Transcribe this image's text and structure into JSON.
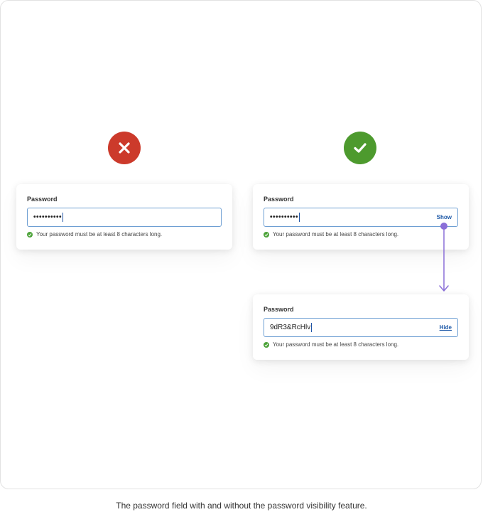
{
  "colors": {
    "bad_badge": "#cc3a2b",
    "good_badge": "#4d9a2e",
    "input_border": "#6e9fd3",
    "link": "#1f5aa8",
    "arrow": "#8b6fd8",
    "hint_check": "#4da33a"
  },
  "bad_example": {
    "badge_icon": "x-mark-icon",
    "field_label": "Password",
    "masked_value": "••••••••••",
    "hint": "Your password must be at least 8 characters long."
  },
  "good_example_hidden": {
    "badge_icon": "checkmark-icon",
    "field_label": "Password",
    "masked_value": "••••••••••",
    "toggle_label": "Show",
    "hint": "Your password must be at least 8 characters long."
  },
  "good_example_shown": {
    "field_label": "Password",
    "plain_value": "9dR3&RcHlv",
    "toggle_label": "Hide",
    "hint": "Your password must be at least 8 characters long."
  },
  "caption": "The password field with and without the password visibility feature."
}
